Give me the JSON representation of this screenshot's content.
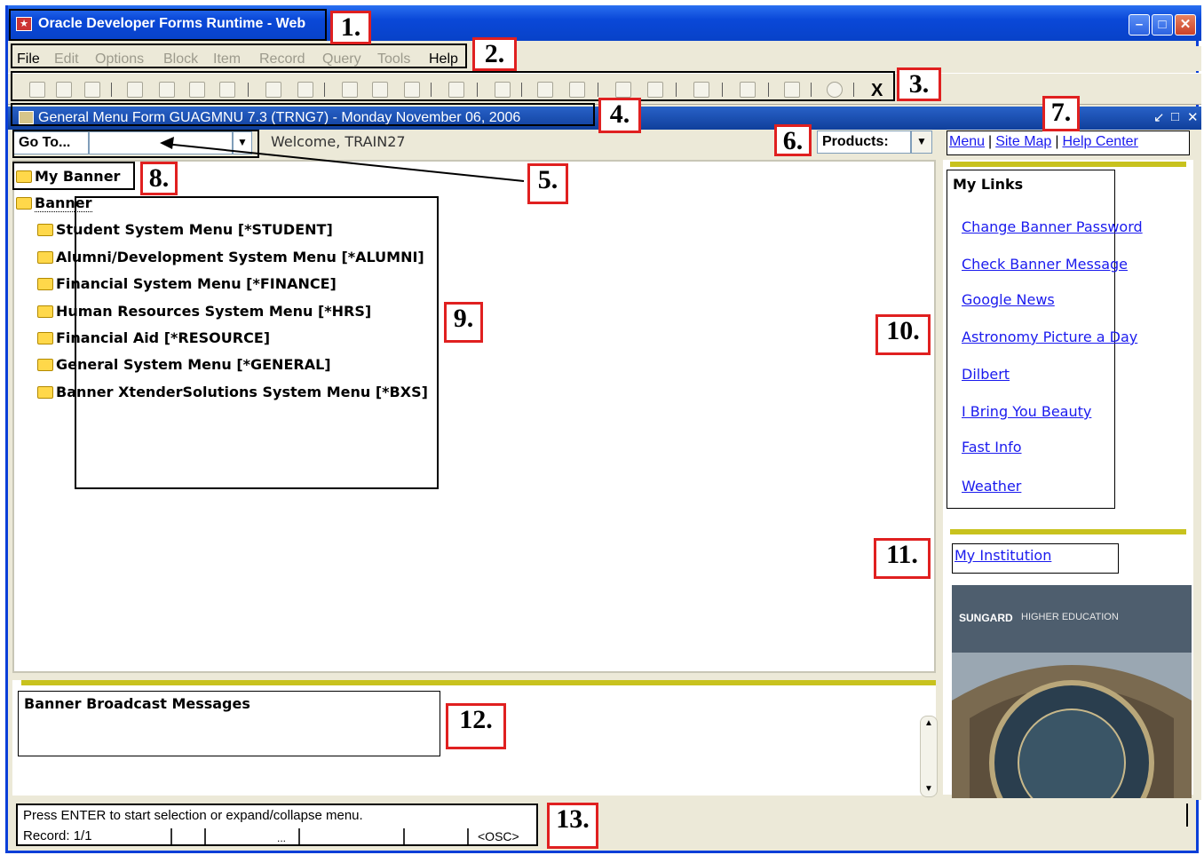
{
  "window": {
    "title": "Oracle Developer Forms Runtime - Web",
    "icon": "oracle-app-icon"
  },
  "menubar": [
    "File",
    "Edit",
    "Options",
    "Block",
    "Item",
    "Record",
    "Query",
    "Tools",
    "Help"
  ],
  "toolbar": {
    "exit_label": "X"
  },
  "formbar": {
    "title": "General Menu Form  GUAGMNU  7.3  (TRNG7) - Monday November 06, 2006"
  },
  "goto": {
    "label": "Go To...",
    "value": ""
  },
  "welcome": "Welcome, TRAIN27",
  "products": {
    "label": "Products:"
  },
  "top_links": [
    "Menu",
    "Site Map",
    "Help Center"
  ],
  "tree": {
    "my_banner": "My Banner",
    "banner": "Banner",
    "items": [
      "Student System Menu [*STUDENT]",
      "Alumni/Development System Menu [*ALUMNI]",
      "Financial System Menu [*FINANCE]",
      "Human Resources System Menu [*HRS]",
      "Financial Aid [*RESOURCE]",
      "General System Menu [*GENERAL]",
      "Banner XtenderSolutions System Menu [*BXS]"
    ]
  },
  "my_links": {
    "title": "My Links",
    "items": [
      "Change Banner Password",
      "Check Banner Message",
      "Google News",
      "Astronomy Picture a Day",
      "Dilbert",
      "I Bring You Beauty",
      "Fast Info",
      "Weather"
    ]
  },
  "my_institution": "My Institution",
  "photo": {
    "brand": "SUNGARD",
    "sub": "HIGHER EDUCATION"
  },
  "broadcast": {
    "title": "Banner Broadcast Messages"
  },
  "status": {
    "message": "Press ENTER to start selection or expand/collapse menu.",
    "record": "Record: 1/1",
    "dots": "...",
    "mode": "<OSC>"
  },
  "callouts": [
    "1.",
    "2.",
    "3.",
    "4.",
    "5.",
    "6.",
    "7.",
    "8.",
    "9.",
    "10.",
    "11.",
    "12.",
    "13."
  ],
  "colors": {
    "titlebar": "#0a48d8",
    "formbar": "#103f9b",
    "link": "#1a1aee",
    "callout_border": "#e02020",
    "olive_divider": "#c8c21e",
    "folder": "#ffd84a"
  }
}
